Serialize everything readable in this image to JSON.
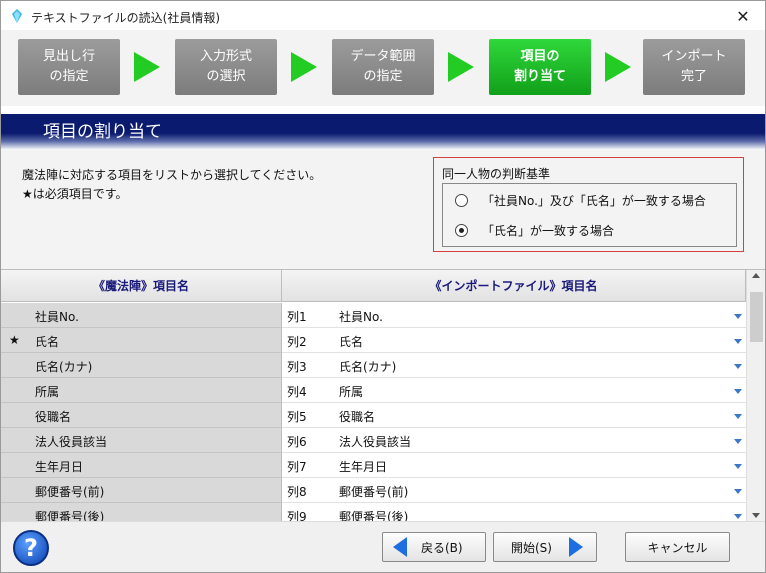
{
  "window": {
    "title": "テキストファイルの読込(社員情報)",
    "close_glyph": "✕"
  },
  "steps": [
    {
      "label": "見出し行\nの指定",
      "active": false
    },
    {
      "label": "入力形式\nの選択",
      "active": false
    },
    {
      "label": "データ範囲\nの指定",
      "active": false
    },
    {
      "label": "項目の\n割り当て",
      "active": true
    },
    {
      "label": "インポート\n完了",
      "active": false
    }
  ],
  "section": {
    "title": "項目の割り当て"
  },
  "instructions": {
    "line1": "魔法陣に対応する項目をリストから選択してください。",
    "line2": "★は必須項目です。"
  },
  "criteria": {
    "label": "同一人物の判断基準",
    "options": [
      {
        "label": "「社員No.」及び「氏名」が一致する場合",
        "selected": false
      },
      {
        "label": "「氏名」が一致する場合",
        "selected": true
      }
    ]
  },
  "grid": {
    "headers": {
      "left": "《魔法陣》項目名",
      "right": "《インポートファイル》項目名"
    },
    "rows": [
      {
        "required": false,
        "field": "社員No.",
        "column": "列1",
        "value": "社員No."
      },
      {
        "required": true,
        "field": "氏名",
        "column": "列2",
        "value": "氏名"
      },
      {
        "required": false,
        "field": "氏名(カナ)",
        "column": "列3",
        "value": "氏名(カナ)"
      },
      {
        "required": false,
        "field": "所属",
        "column": "列4",
        "value": "所属"
      },
      {
        "required": false,
        "field": "役職名",
        "column": "列5",
        "value": "役職名"
      },
      {
        "required": false,
        "field": "法人役員該当",
        "column": "列6",
        "value": "法人役員該当"
      },
      {
        "required": false,
        "field": "生年月日",
        "column": "列7",
        "value": "生年月日"
      },
      {
        "required": false,
        "field": "郵便番号(前)",
        "column": "列8",
        "value": "郵便番号(前)"
      },
      {
        "required": false,
        "field": "郵便番号(後)",
        "column": "列9",
        "value": "郵便番号(後)"
      }
    ],
    "required_mark": "★"
  },
  "buttons": {
    "back": "戻る(B)",
    "start": "開始(S)",
    "cancel": "キャンセル",
    "help_glyph": "?"
  },
  "colors": {
    "active_step": "#22cc22",
    "header_band": "#0a1a6e",
    "criteria_border": "#d44040",
    "accent_arrow": "#1d6ee0"
  }
}
